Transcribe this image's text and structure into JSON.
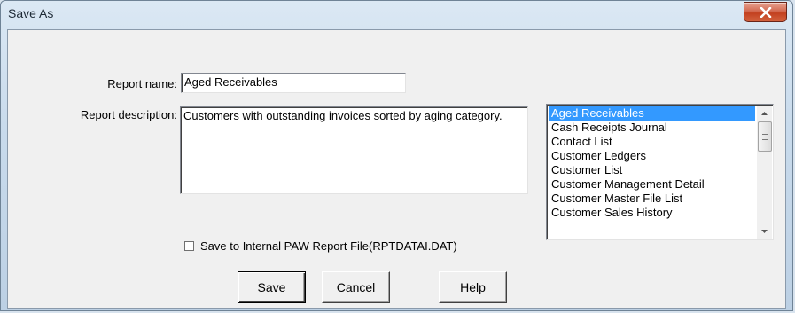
{
  "window": {
    "title": "Save As",
    "close_icon": "close-icon"
  },
  "form": {
    "report_name_label": "Report name:",
    "report_name_value": "Aged Receivables",
    "report_description_label": "Report description:",
    "report_description_value": "Customers with outstanding invoices sorted by aging category.",
    "checkbox_label": "Save to Internal PAW Report File(RPTDATAI.DAT)",
    "checkbox_checked": false
  },
  "report_list": {
    "items": [
      "Aged Receivables",
      "Cash Receipts Journal",
      "Contact List",
      "Customer Ledgers",
      "Customer List",
      "Customer Management Detail",
      "Customer Master File List",
      "Customer Sales History"
    ],
    "selected_index": 0
  },
  "buttons": {
    "save": "Save",
    "cancel": "Cancel",
    "help": "Help"
  },
  "colors": {
    "selection": "#3399ff",
    "close_button": "#c2401f"
  }
}
